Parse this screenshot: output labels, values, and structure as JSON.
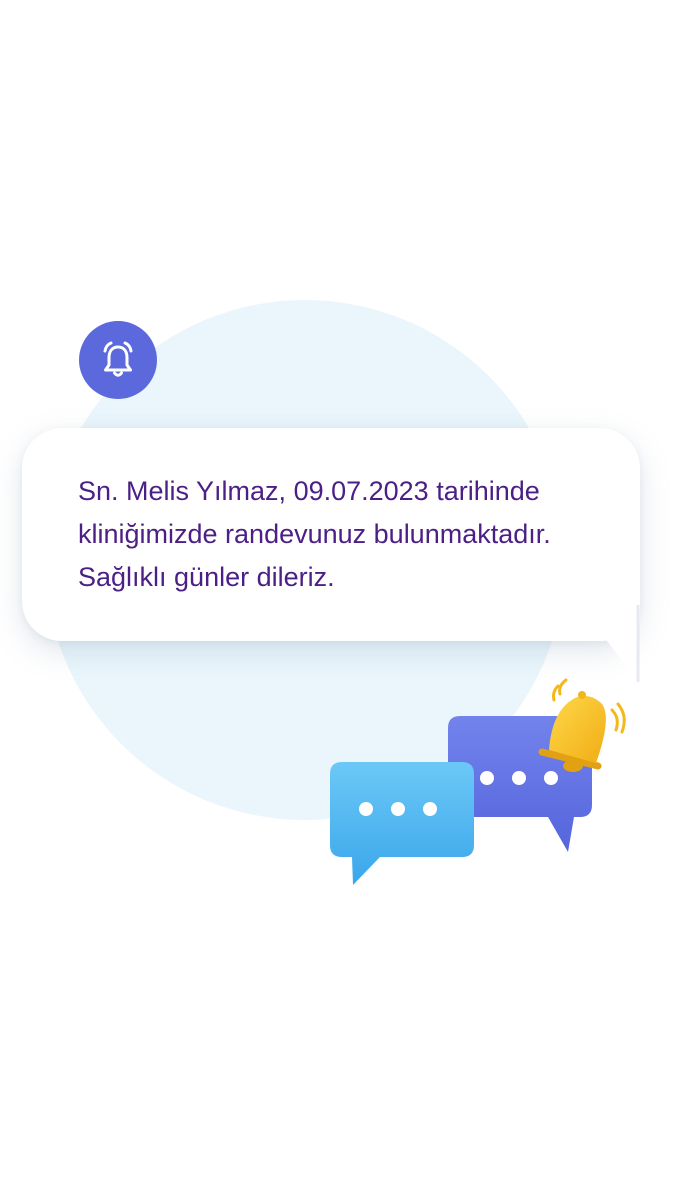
{
  "notification": {
    "icon": "alarm-bell-icon",
    "message": "Sn. Melis Yılmaz, 09.07.2023 tarihinde kliniğimizde randevunuz bulunmaktadır. Sağlıklı günler dileriz."
  },
  "illustration": {
    "left_bubble_icon": "chat-bubble-icon",
    "right_bubble_icon": "chat-bubble-icon",
    "bell_icon": "ringing-bell-icon"
  },
  "colors": {
    "background": "#ffffff",
    "circle": "#eaf6fc",
    "badge": "#5b69dd",
    "text": "#4b1f86",
    "chat_blue_light": "#4fb6f2",
    "chat_blue_dark": "#5e72e4",
    "bell_yellow": "#f7c325"
  }
}
